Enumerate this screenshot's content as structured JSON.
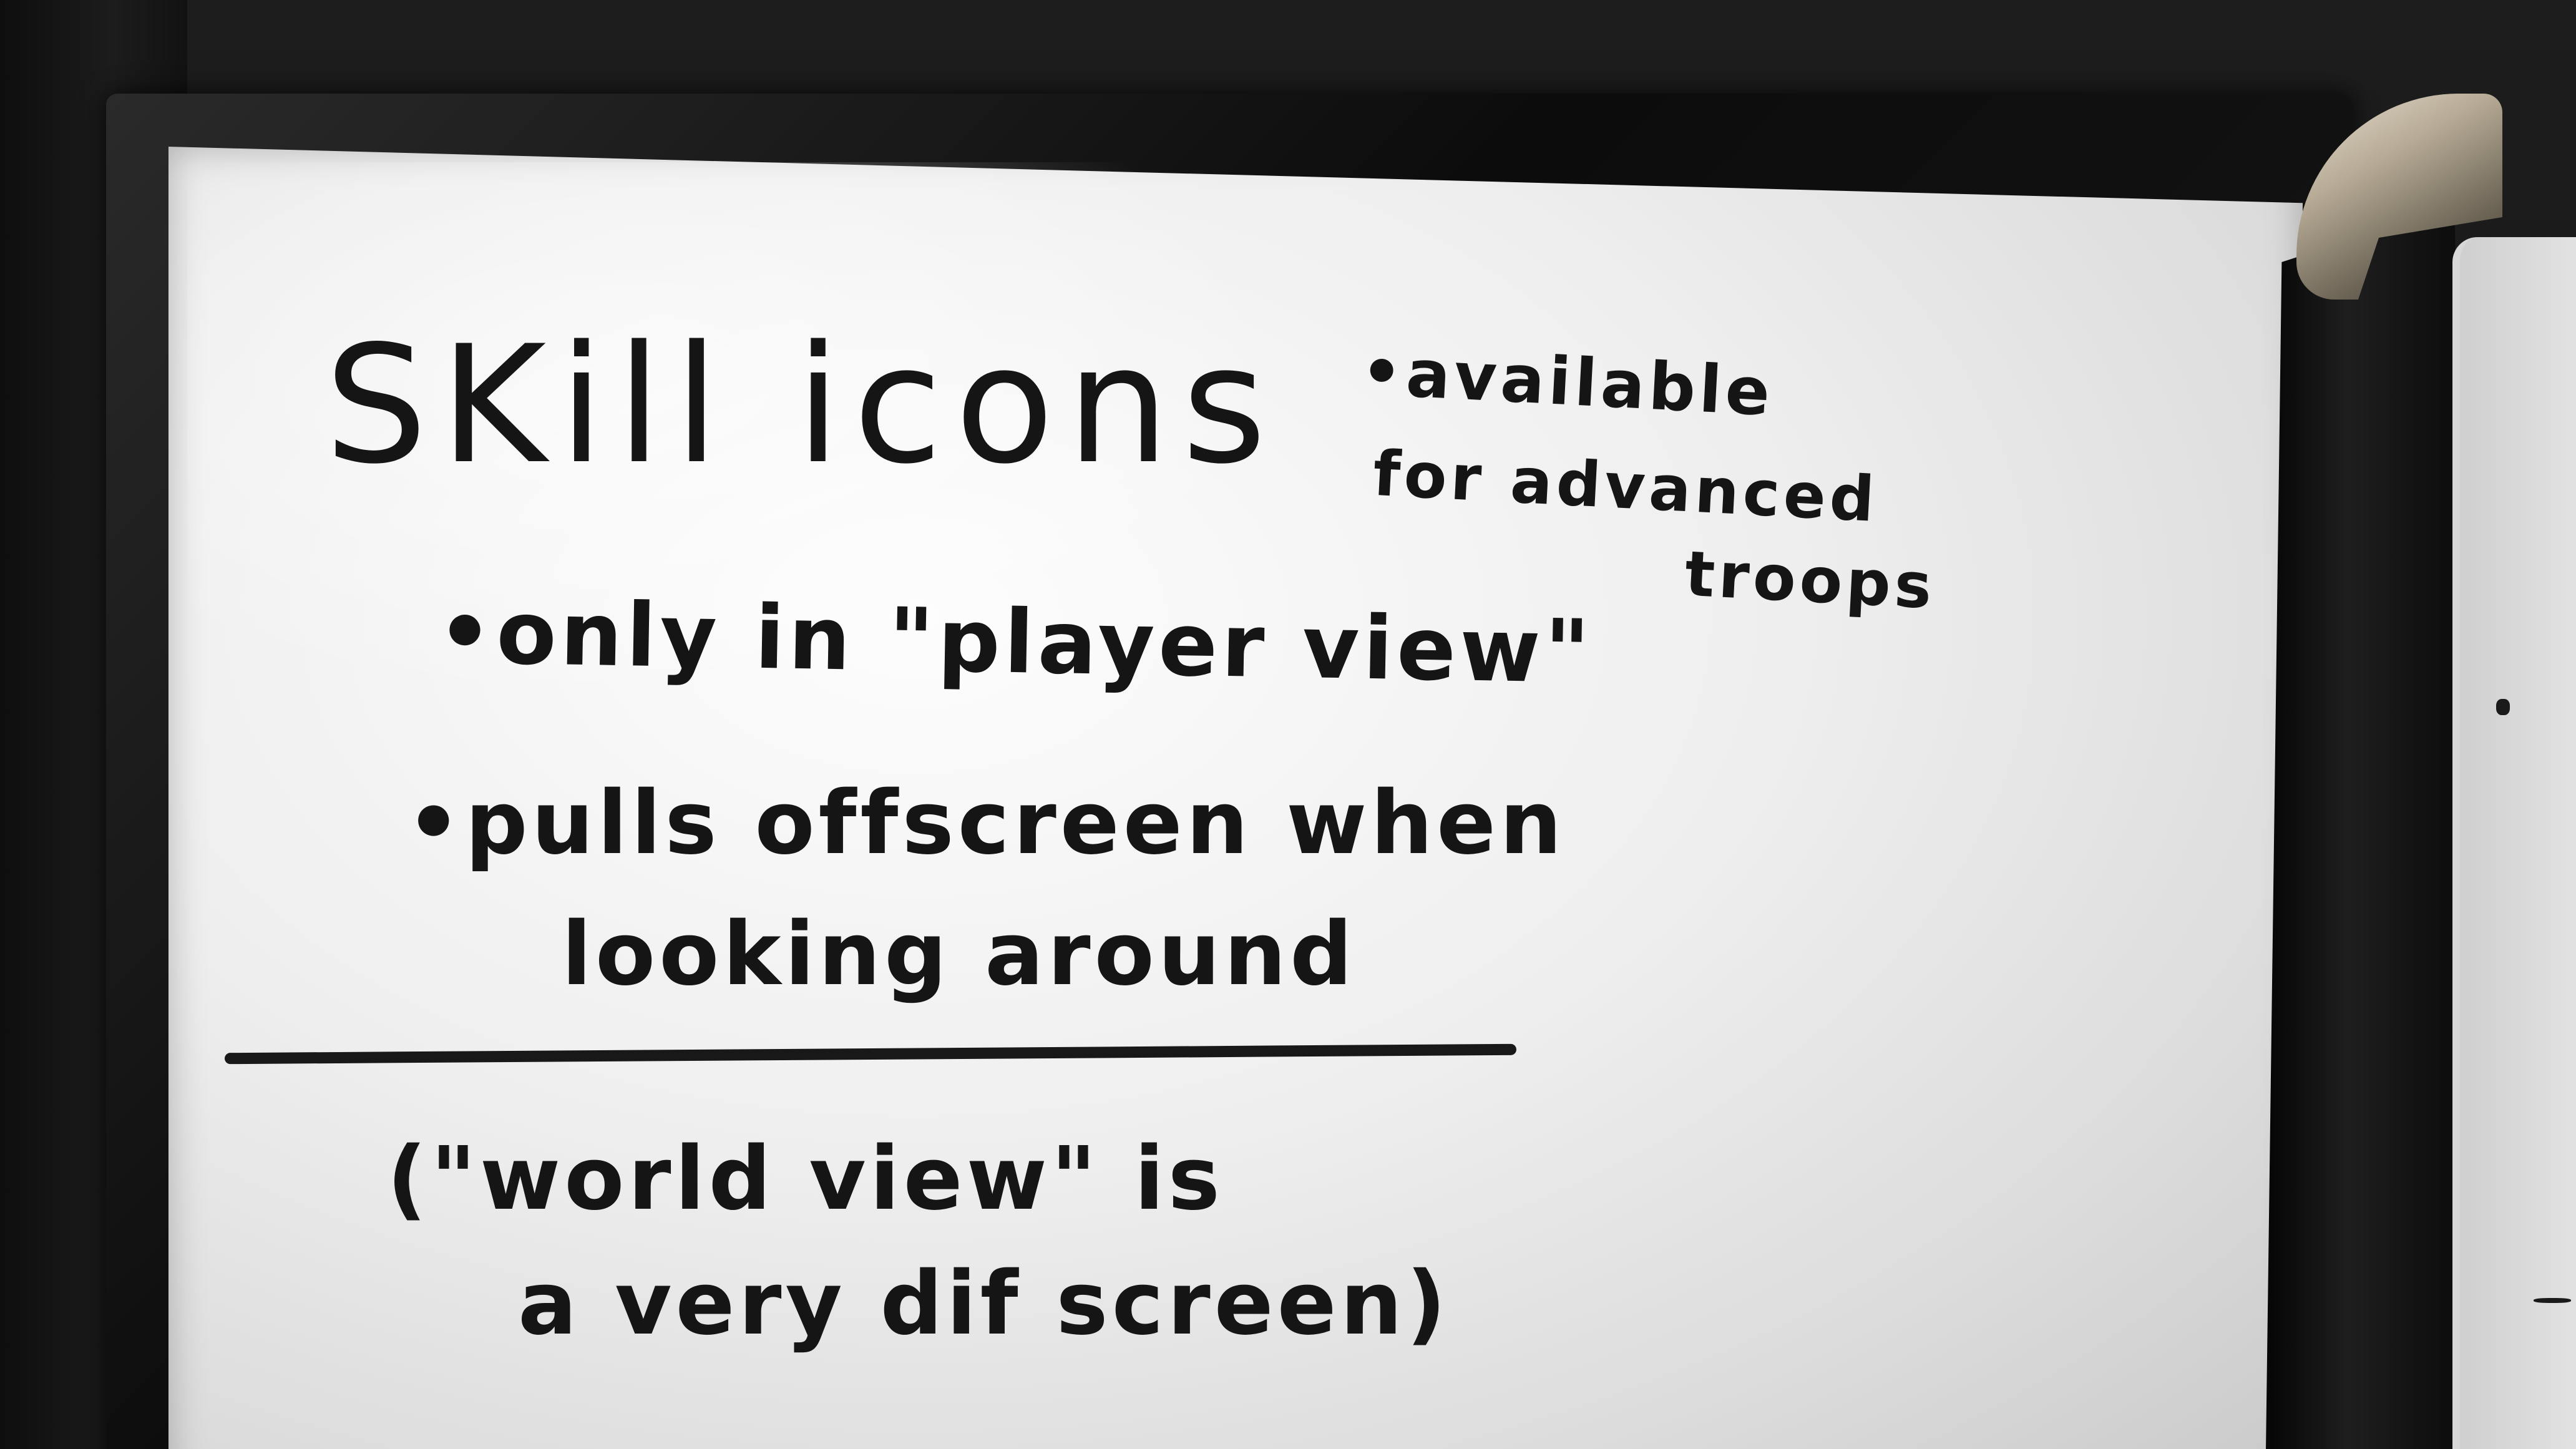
{
  "whiteboard": {
    "title": "SKill icons",
    "side_note": {
      "line1": "•available",
      "line2": "for advanced",
      "line3": "troops"
    },
    "bullets": {
      "bullet1": "•only in \"player view\"",
      "bullet2_line1": "•pulls offscreen when",
      "bullet2_line2": "looking around"
    },
    "parenthetical": {
      "line1": "(\"world view\" is",
      "line2": "a very dif screen)"
    }
  }
}
